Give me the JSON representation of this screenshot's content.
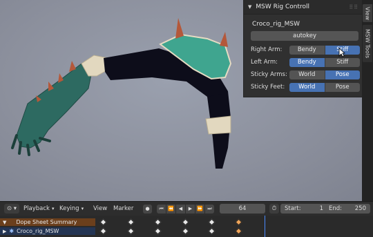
{
  "panel": {
    "title": "MSW Rig Controll",
    "rig_name": "Croco_rig_MSW",
    "autokey_label": "autokey",
    "rows": [
      {
        "label": "Right Arm:",
        "options": [
          "Bendy",
          "Stiff"
        ],
        "selected": 1
      },
      {
        "label": "Left Arm:",
        "options": [
          "Bendy",
          "Stiff"
        ],
        "selected": 0
      },
      {
        "label": "Sticky Arms:",
        "options": [
          "World",
          "Pose"
        ],
        "selected": 1
      },
      {
        "label": "Sticky Feet:",
        "options": [
          "World",
          "Pose"
        ],
        "selected": 0
      }
    ]
  },
  "side_tabs": [
    "View",
    "MSW Tools"
  ],
  "timeline": {
    "playback_label": "Playback",
    "keying_label": "Keying",
    "view_label": "View",
    "marker_label": "Marker",
    "current_frame": "64",
    "start_label": "Start:",
    "start_value": "1",
    "end_label": "End:",
    "end_value": "250"
  },
  "dopesheet": {
    "summary_label": "Dope Sheet Summary",
    "object_label": "Croco_rig_MSW"
  },
  "colors": {
    "accent": "#4772b3",
    "summary_row": "#6b3f1c",
    "object_row": "#243553",
    "skin": "#2e6b62",
    "sleeve": "#0c0c18",
    "bandage": "#e6dcc3",
    "spike": "#b35a3a",
    "key_selected": "#f0a55a"
  }
}
